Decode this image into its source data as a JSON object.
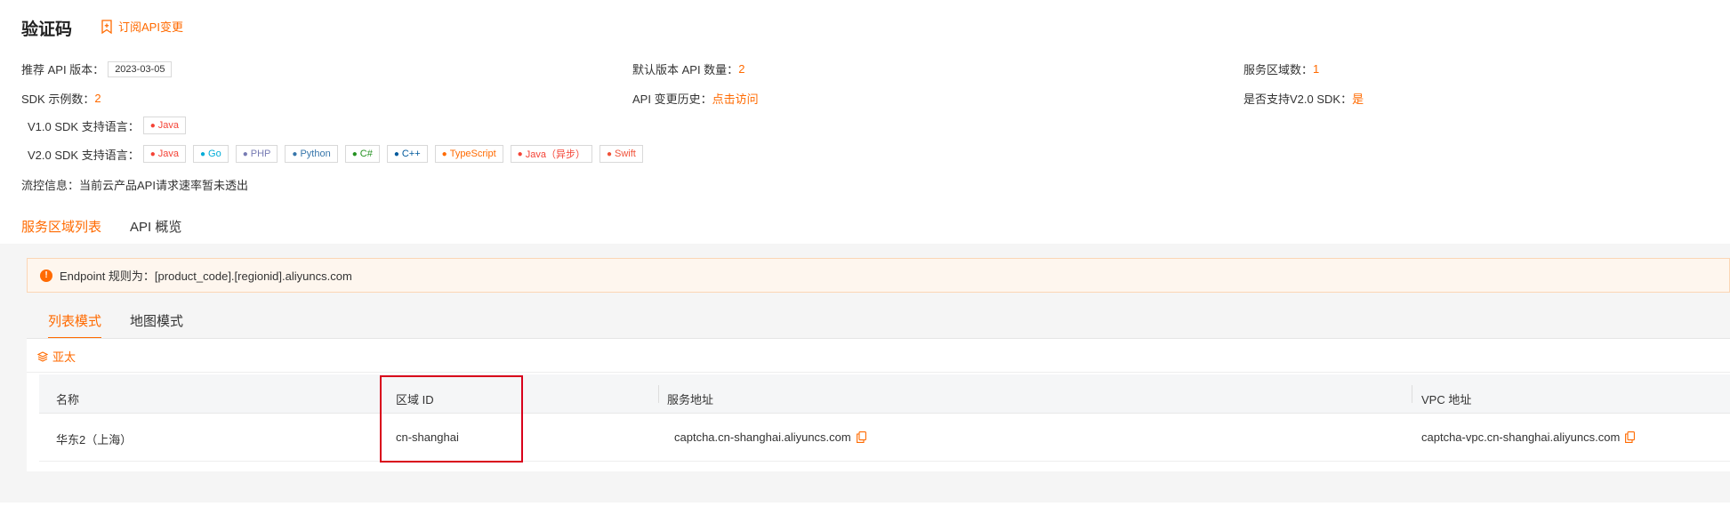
{
  "page": {
    "title": "验证码",
    "subscribe_label": "订阅API变更"
  },
  "info": {
    "recommended_api_version_label": "推荐 API 版本：",
    "recommended_api_version_value": "2023-03-05",
    "default_api_count_label": "默认版本 API 数量：",
    "default_api_count_value": "2",
    "region_count_label": "服务区域数：",
    "region_count_value": "1",
    "sdk_examples_label": "SDK 示例数：",
    "sdk_examples_value": "2",
    "api_history_label": "API 变更历史：",
    "api_history_link": "点击访问",
    "v2_support_label": "是否支持V2.0 SDK：",
    "v2_support_value": "是",
    "v1_sdk_label": "V1.0 SDK 支持语言：",
    "v2_sdk_label": "V2.0 SDK 支持语言：",
    "flow_control": "流控信息：当前云产品API请求速率暂未透出"
  },
  "v1_languages": [
    {
      "name": "Java",
      "icon": "java-icon",
      "color": "#f44336"
    }
  ],
  "v2_languages": [
    {
      "name": "Java",
      "icon": "java-icon",
      "color": "#f44336"
    },
    {
      "name": "Go",
      "icon": "go-icon",
      "color": "#00acd7"
    },
    {
      "name": "PHP",
      "icon": "php-icon",
      "color": "#777bb3"
    },
    {
      "name": "Python",
      "icon": "python-icon",
      "color": "#3776ab"
    },
    {
      "name": "C#",
      "icon": "csharp-icon",
      "color": "#239120"
    },
    {
      "name": "C++",
      "icon": "cpp-icon",
      "color": "#00599c"
    },
    {
      "name": "TypeScript",
      "icon": "typescript-icon",
      "color": "#ff6a00"
    },
    {
      "name": "Java（异步）",
      "icon": "java-icon",
      "color": "#f44336"
    },
    {
      "name": "Swift",
      "icon": "swift-icon",
      "color": "#f05138"
    }
  ],
  "tabs": [
    {
      "label": "服务区域列表",
      "active": true
    },
    {
      "label": "API 概览",
      "active": false
    }
  ],
  "notice": {
    "text": "Endpoint 规则为：[product_code].[regionid].aliyuncs.com"
  },
  "subtabs": [
    {
      "label": "列表模式",
      "active": true
    },
    {
      "label": "地图模式",
      "active": false
    }
  ],
  "region_group": "亚太",
  "table": {
    "headers": [
      "名称",
      "区域 ID",
      "服务地址",
      "VPC 地址"
    ],
    "rows": [
      [
        "华东2（上海）",
        "cn-shanghai",
        "captcha.cn-shanghai.aliyuncs.com",
        "captcha-vpc.cn-shanghai.aliyuncs.com"
      ]
    ]
  },
  "colors": {
    "accent": "#ff6a00",
    "highlight_box": "#d9001b"
  }
}
